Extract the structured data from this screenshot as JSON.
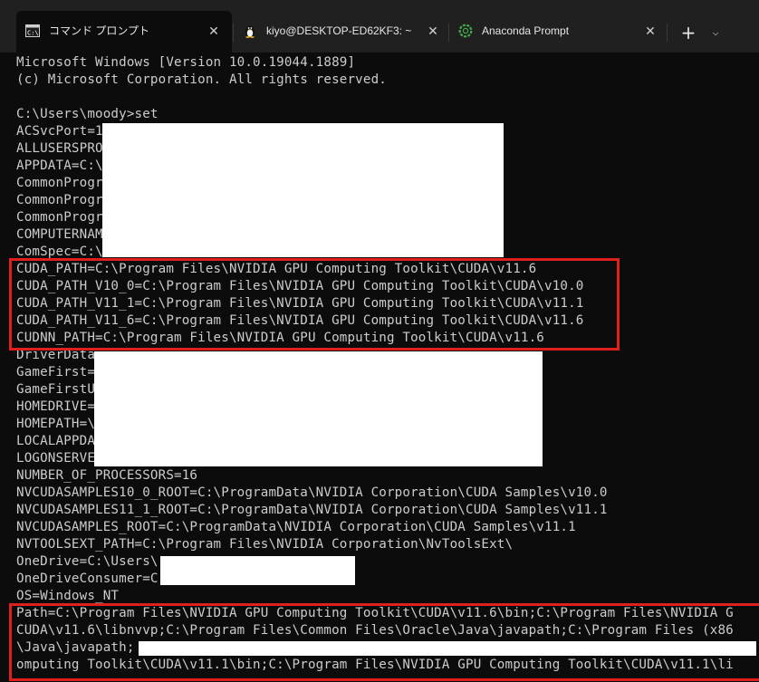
{
  "tabs": [
    {
      "label": "コマンド プロンプト",
      "icon": "cmd-icon",
      "active": true
    },
    {
      "label": "kiyo@DESKTOP-ED62KF3: ~",
      "icon": "linux-penguin-icon",
      "active": false
    },
    {
      "label": "Anaconda Prompt",
      "icon": "anaconda-icon",
      "active": false
    }
  ],
  "tab_close_glyph": "✕",
  "new_tab_glyph": "+",
  "dropdown_glyph": "⌵",
  "lines": [
    "Microsoft Windows [Version 10.0.19044.1889]",
    "(c) Microsoft Corporation. All rights reserved.",
    "",
    "C:\\Users\\moody>set",
    "ACSvcPort=1",
    "ALLUSERSPRO",
    "APPDATA=C:\\",
    "CommonProgr",
    "CommonProgr",
    "CommonProgr",
    "COMPUTERNAM",
    "ComSpec=C:\\",
    "CUDA_PATH=C:\\Program Files\\NVIDIA GPU Computing Toolkit\\CUDA\\v11.6",
    "CUDA_PATH_V10_0=C:\\Program Files\\NVIDIA GPU Computing Toolkit\\CUDA\\v10.0",
    "CUDA_PATH_V11_1=C:\\Program Files\\NVIDIA GPU Computing Toolkit\\CUDA\\v11.1",
    "CUDA_PATH_V11_6=C:\\Program Files\\NVIDIA GPU Computing Toolkit\\CUDA\\v11.6",
    "CUDNN_PATH=C:\\Program Files\\NVIDIA GPU Computing Toolkit\\CUDA\\v11.6",
    "DriverData",
    "GameFirst=",
    "GameFirstU",
    "HOMEDRIVE=",
    "HOMEPATH=\\",
    "LOCALAPPDA",
    "LOGONSERVE",
    "NUMBER_OF_PROCESSORS=16",
    "NVCUDASAMPLES10_0_ROOT=C:\\ProgramData\\NVIDIA Corporation\\CUDA Samples\\v10.0",
    "NVCUDASAMPLES11_1_ROOT=C:\\ProgramData\\NVIDIA Corporation\\CUDA Samples\\v11.1",
    "NVCUDASAMPLES_ROOT=C:\\ProgramData\\NVIDIA Corporation\\CUDA Samples\\v11.1",
    "NVTOOLSEXT_PATH=C:\\Program Files\\NVIDIA Corporation\\NvToolsExt\\",
    "OneDrive=C:\\Users\\",
    "OneDriveConsumer=C",
    "OS=Windows_NT",
    "Path=C:\\Program Files\\NVIDIA GPU Computing Toolkit\\CUDA\\v11.6\\bin;C:\\Program Files\\NVIDIA G",
    "CUDA\\v11.6\\libnvvp;C:\\Program Files\\Common Files\\Oracle\\Java\\javapath;C:\\Program Files (x86",
    "\\Java\\javapath;",
    "omputing Toolkit\\CUDA\\v11.1\\bin;C:\\Program Files\\NVIDIA GPU Computing Toolkit\\CUDA\\v11.1\\li"
  ],
  "colors": {
    "console_background": "#0c0c0c",
    "console_text": "#cccccc",
    "tabbar_background": "#202020",
    "highlight_border": "#e0201e",
    "redaction": "#ffffff"
  }
}
